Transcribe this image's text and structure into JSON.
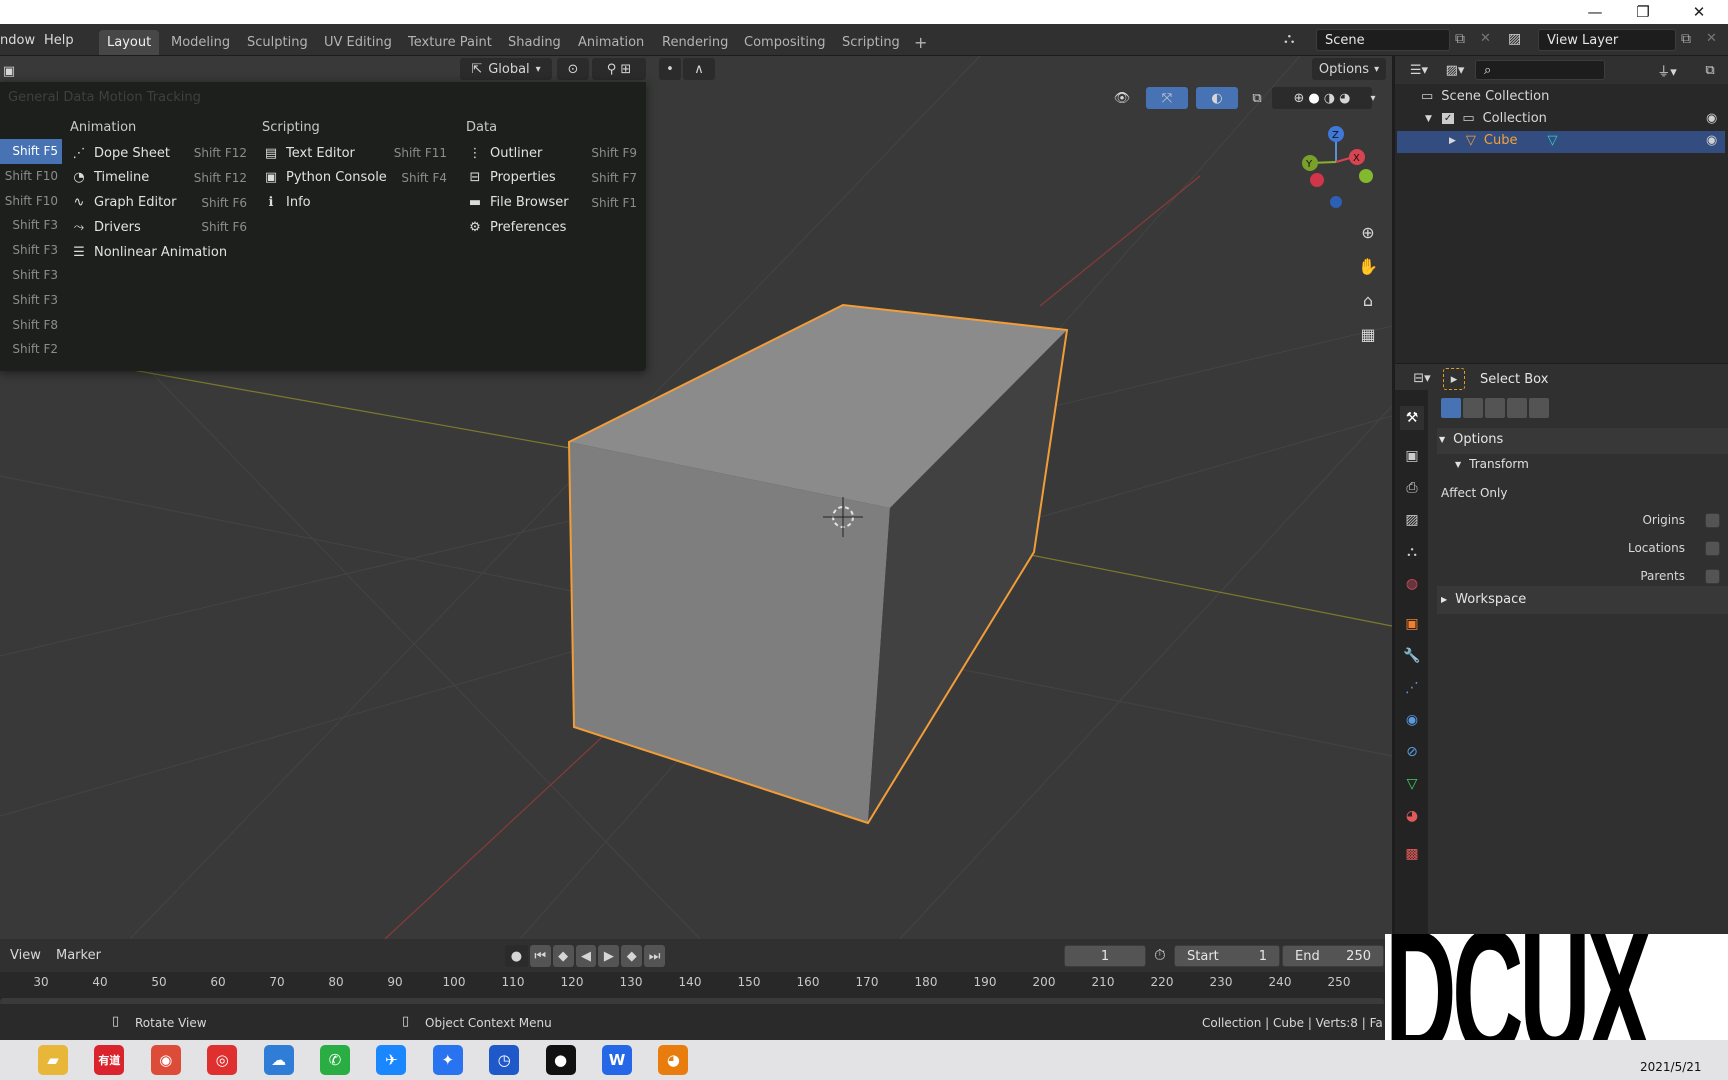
{
  "window": {
    "minimize": "—",
    "restore": "❐",
    "close": "✕"
  },
  "topbar": {
    "menus": [
      "ndow",
      "Help"
    ],
    "tabs": [
      "Layout",
      "Modeling",
      "Sculpting",
      "UV Editing",
      "Texture Paint",
      "Shading",
      "Animation",
      "Rendering",
      "Compositing",
      "Scripting"
    ],
    "add_tab": "+",
    "scene": "Scene",
    "view_layer": "View Layer"
  },
  "viewport_header": {
    "orientation": "Global",
    "options": "Options"
  },
  "editor_menu": {
    "faded_label": "General Data  Motion Tracking",
    "left_shortcuts": [
      "Shift F5",
      "Shift F10",
      "Shift F10",
      "Shift F3",
      "Shift F3",
      "Shift F3",
      "Shift F3",
      "Shift F8",
      "Shift F2"
    ],
    "columns": [
      {
        "title": "Animation",
        "items": [
          {
            "icon": "dope-sheet-icon",
            "glyph": "⋰",
            "label": "Dope Sheet",
            "shortcut": "Shift F12"
          },
          {
            "icon": "timeline-icon",
            "glyph": "◔",
            "label": "Timeline",
            "shortcut": "Shift F12"
          },
          {
            "icon": "graph-editor-icon",
            "glyph": "∿",
            "label": "Graph Editor",
            "shortcut": "Shift F6"
          },
          {
            "icon": "drivers-icon",
            "glyph": "⤳",
            "label": "Drivers",
            "shortcut": "Shift F6"
          },
          {
            "icon": "nla-icon",
            "glyph": "☰",
            "label": "Nonlinear Animation",
            "shortcut": ""
          }
        ]
      },
      {
        "title": "Scripting",
        "items": [
          {
            "icon": "text-editor-icon",
            "glyph": "▤",
            "label": "Text Editor",
            "shortcut": "Shift F11"
          },
          {
            "icon": "python-console-icon",
            "glyph": "▣",
            "label": "Python Console",
            "shortcut": "Shift F4"
          },
          {
            "icon": "info-icon",
            "glyph": "ℹ",
            "label": "Info",
            "shortcut": ""
          }
        ]
      },
      {
        "title": "Data",
        "items": [
          {
            "icon": "outliner-icon",
            "glyph": "⋮",
            "label": "Outliner",
            "shortcut": "Shift F9"
          },
          {
            "icon": "properties-icon",
            "glyph": "⊟",
            "label": "Properties",
            "shortcut": "Shift F7"
          },
          {
            "icon": "file-browser-icon",
            "glyph": "▬",
            "label": "File Browser",
            "shortcut": "Shift F1"
          },
          {
            "icon": "preferences-icon",
            "glyph": "⚙",
            "label": "Preferences",
            "shortcut": ""
          }
        ]
      }
    ]
  },
  "gizmo": {
    "x": "X",
    "y": "Y",
    "z": "Z"
  },
  "outliner": {
    "items": [
      {
        "label": "Scene Collection"
      },
      {
        "label": "Collection"
      },
      {
        "label": "Cube"
      }
    ]
  },
  "properties": {
    "tool": "Select Box",
    "options": "Options",
    "transform": "Transform",
    "affect_only": "Affect Only",
    "checks": [
      "Origins",
      "Locations",
      "Parents"
    ],
    "workspace": "Workspace"
  },
  "timeline": {
    "menus": [
      "View",
      "Marker"
    ],
    "current_frame": "1",
    "start_label": "Start",
    "start": "1",
    "end_label": "End",
    "end": "250",
    "ticks": [
      "30",
      "40",
      "50",
      "60",
      "70",
      "80",
      "90",
      "100",
      "110",
      "120",
      "130",
      "140",
      "150",
      "160",
      "170",
      "180",
      "190",
      "200",
      "210",
      "220",
      "230",
      "240",
      "250"
    ]
  },
  "status": {
    "rotate": "Rotate View",
    "context": "Object Context Menu",
    "info": "Collection | Cube | Verts:8 | Fa"
  },
  "taskbar": {
    "date": "2021/5/21",
    "apps": [
      {
        "name": "file-explorer-icon",
        "glyph": "▰",
        "color": "#e8b73a"
      },
      {
        "name": "youdao-icon",
        "glyph": "有道",
        "color": "#d9232d"
      },
      {
        "name": "chrome-icon",
        "glyph": "◉",
        "color": "#dd4b39"
      },
      {
        "name": "netease-music-icon",
        "glyph": "◎",
        "color": "#e02f2f"
      },
      {
        "name": "baidu-netdisk-icon",
        "glyph": "☁",
        "color": "#2f7dd6"
      },
      {
        "name": "wechat-icon",
        "glyph": "✆",
        "color": "#2aae43"
      },
      {
        "name": "dingtalk-icon",
        "glyph": "✈",
        "color": "#1b87ff"
      },
      {
        "name": "feishu-icon",
        "glyph": "✦",
        "color": "#2a73f0"
      },
      {
        "name": "clock-app-icon",
        "glyph": "◷",
        "color": "#1f58c9"
      },
      {
        "name": "recorder-icon",
        "glyph": "●",
        "color": "#111111"
      },
      {
        "name": "wps-icon",
        "glyph": "W",
        "color": "#2468e8"
      },
      {
        "name": "blender-icon",
        "glyph": "◕",
        "color": "#e87d0d"
      }
    ]
  },
  "watermark": "DCUX"
}
